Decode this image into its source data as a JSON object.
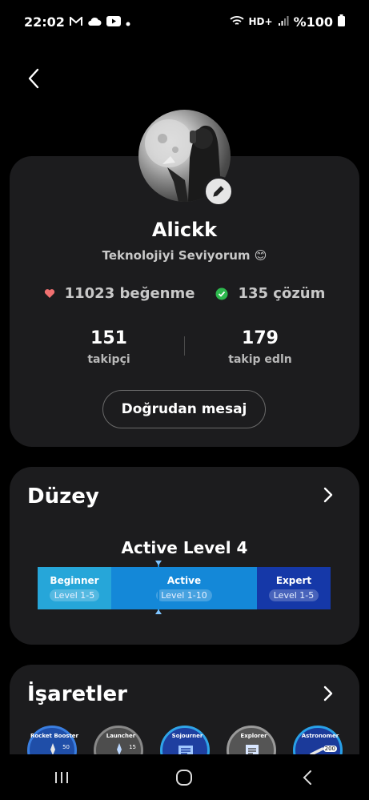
{
  "status_bar": {
    "time": "22:02",
    "left_icons": [
      "gmail-icon",
      "cloud-icon",
      "youtube-icon",
      "dot-icon"
    ],
    "network": "HD+",
    "battery": "%100"
  },
  "profile": {
    "name": "Alickk",
    "bio": "Teknolojiyi Seviyorum 😊",
    "likes": "11023 beğenme",
    "solutions": "135 çözüm",
    "followers_count": "151",
    "followers_label": "takipçi",
    "following_count": "179",
    "following_label": "takip edln",
    "dm_label": "Doğrudan mesaj"
  },
  "level": {
    "title": "Düzey",
    "current": "Active Level 4",
    "segments": [
      {
        "name": "Beginner",
        "range": "Level 1-5"
      },
      {
        "name": "Active",
        "range": "Level 1-10"
      },
      {
        "name": "Expert",
        "range": "Level 1-5"
      }
    ]
  },
  "badges": {
    "title": "İşaretler",
    "items": [
      {
        "name": "Rocket Booster",
        "icon": "rocket-icon",
        "count": "50"
      },
      {
        "name": "Launcher",
        "icon": "launcher-icon",
        "count": "15"
      },
      {
        "name": "Sojourner",
        "icon": "notebook-icon",
        "count": ""
      },
      {
        "name": "Explorer",
        "icon": "clipboard-icon",
        "count": ""
      },
      {
        "name": "Astronomer",
        "icon": "telescope-icon",
        "count": "200"
      }
    ]
  },
  "colors": {
    "card_bg": "#1c1c1e",
    "heart": "#f07070",
    "check": "#2db84d",
    "beginner": "#26a6d9",
    "active": "#1488d8",
    "expert": "#1538a8"
  }
}
